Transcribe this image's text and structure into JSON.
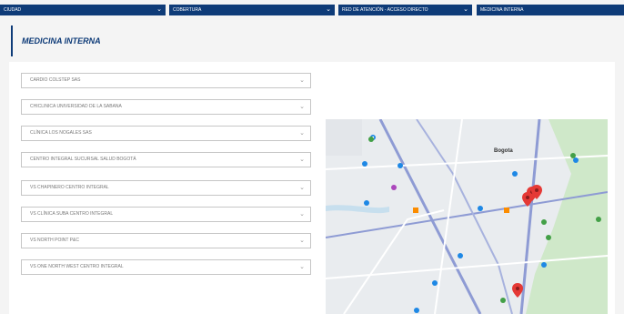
{
  "filters": [
    {
      "label": "Ciudad"
    },
    {
      "label": "Cobertura"
    },
    {
      "label": "Red de atención - Acceso directo"
    },
    {
      "label": "Medicina interna"
    }
  ],
  "page_title": "MEDICINA INTERNA",
  "providers": [
    {
      "label": "Cardio Colstep SAS"
    },
    {
      "label": "Chiclinica Universidad de la Sabana"
    },
    {
      "label": "Clínica los Nogales SAS"
    },
    {
      "label": "Centro Integral Sucursal Salud Bogotá"
    },
    {
      "label": "VS Chapinero Centro Integral"
    },
    {
      "label": "VS Clínica Suba Centro Integral"
    },
    {
      "label": "VS North Point P&C"
    },
    {
      "label": "VS One North West Centro Integral"
    }
  ],
  "map": {
    "city_label": "Bogota",
    "marker_color": "#e53935",
    "water_color": "#c7dfee",
    "park_color": "#cfe8c9"
  },
  "colors": {
    "brand": "#0e3b78",
    "background": "#f4f4f4"
  }
}
